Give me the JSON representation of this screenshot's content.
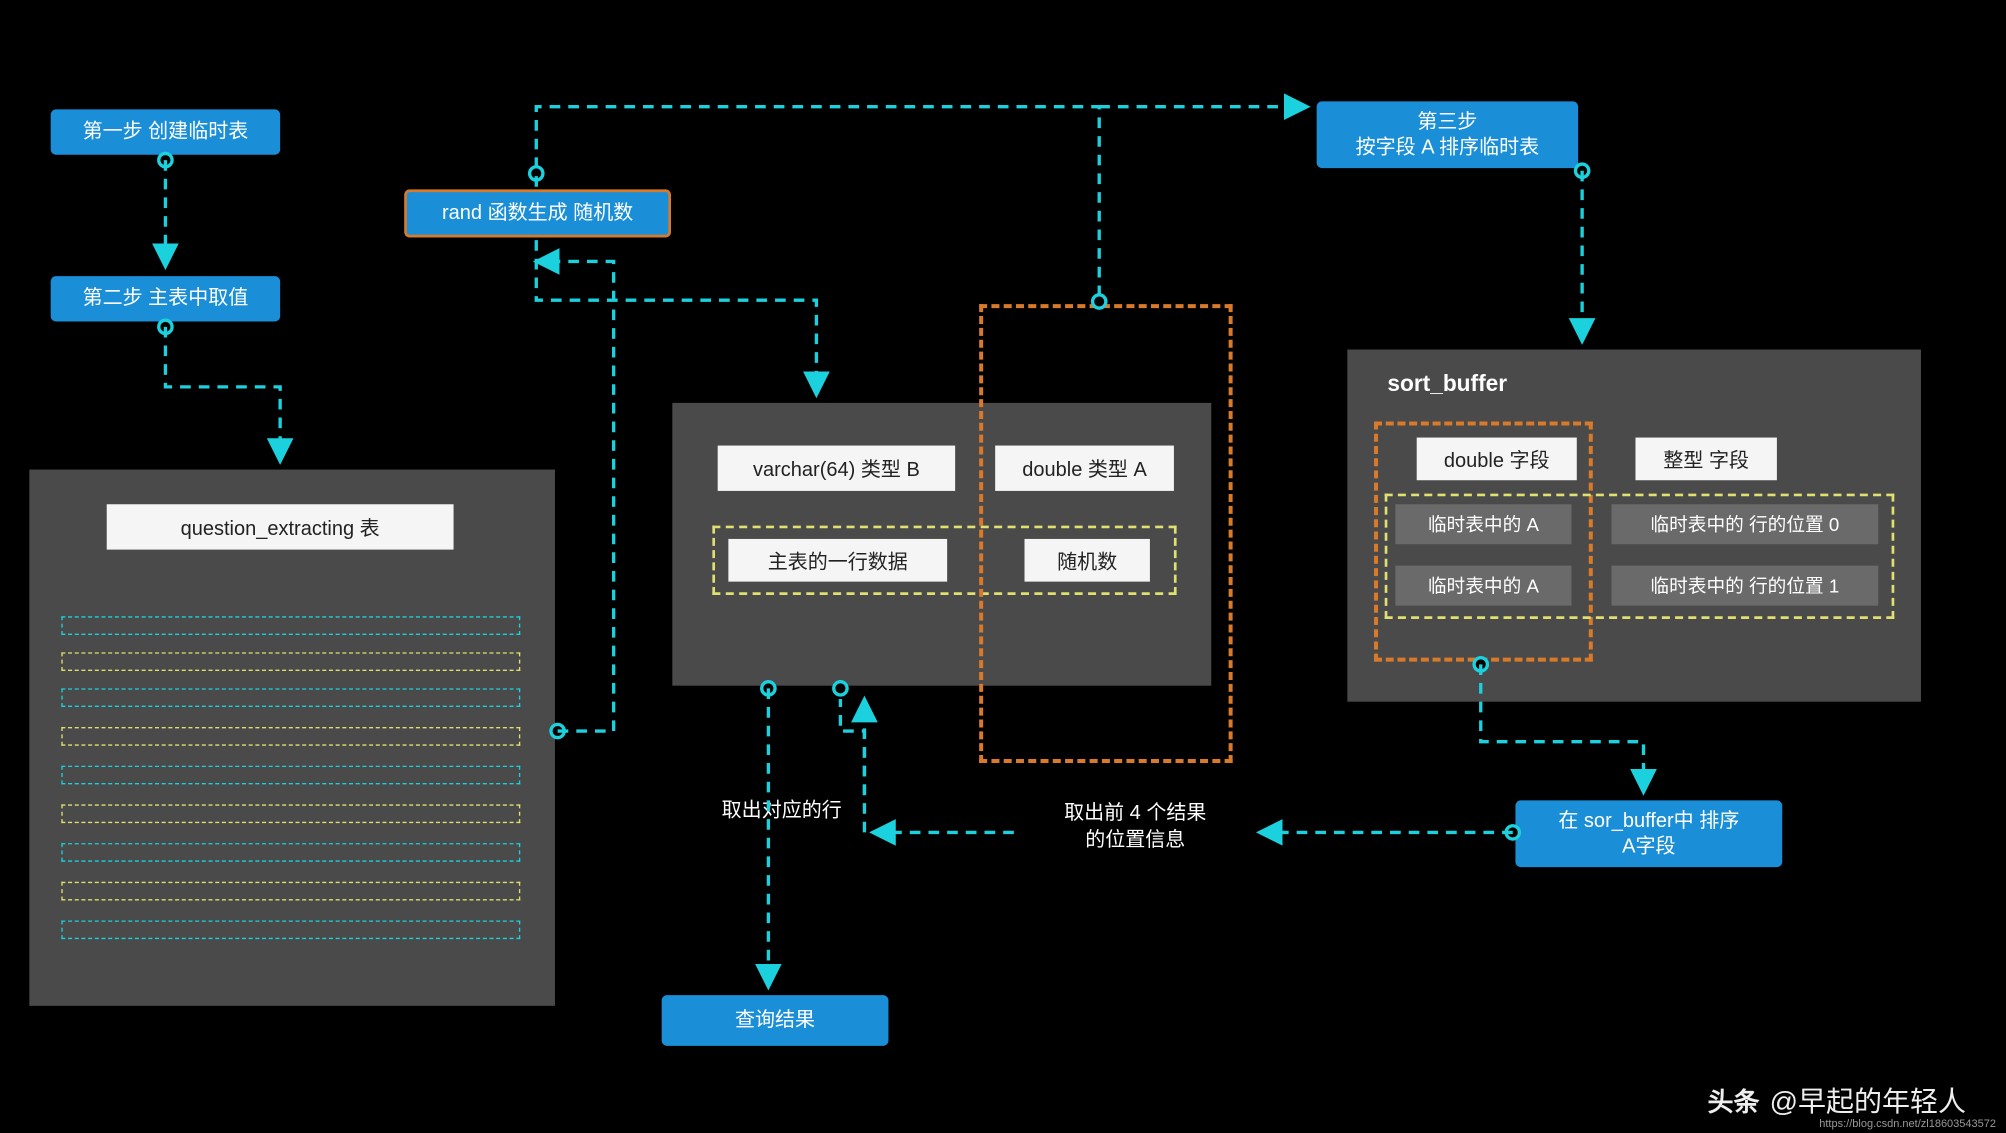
{
  "nodes": {
    "step1": "第一步 创建临时表",
    "step2": "第二步 主表中取值",
    "rand": "rand 函数生成 随机数",
    "step3_line1": "第三步",
    "step3_line2": "按字段 A 排序临时表",
    "sort_action_line1": "在 sor_buffer中 排序",
    "sort_action_line2": "A字段",
    "result": "查询结果"
  },
  "left_panel": {
    "title": "question_extracting 表"
  },
  "mid_panel": {
    "varcharB": "varchar(64) 类型 B",
    "doubleA": "double 类型 A",
    "rowData": "主表的一行数据",
    "randNum": "随机数"
  },
  "sort_buffer": {
    "title": "sort_buffer",
    "doubleField": "double 字段",
    "intField": "整型 字段",
    "a0": "临时表中的 A",
    "pos0": "临时表中的 行的位置 0",
    "a1": "临时表中的 A",
    "pos1": "临时表中的 行的位置 1"
  },
  "labels": {
    "takeRow": "取出对应的行",
    "take4_line1": "取出前 4 个结果",
    "take4_line2": "的位置信息"
  },
  "watermark": {
    "head": "头条",
    "author": "@早起的年轻人",
    "url": "https://blog.csdn.net/zl18603543572"
  }
}
